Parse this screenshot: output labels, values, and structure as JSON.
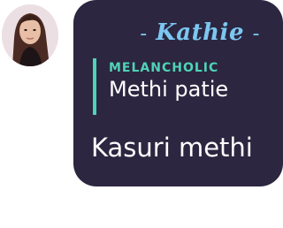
{
  "avatar": {
    "icon": "profile-photo"
  },
  "message": {
    "sender_dash_left": "-",
    "sender_name": "Kathie",
    "sender_dash_right": "-",
    "quote": {
      "title": "MELANCHOLIC",
      "text": "Methi patie"
    },
    "body": "Kasuri methi"
  },
  "colors": {
    "bubble": "#2c2640",
    "sender": "#7cc7f1",
    "quote_accent": "#4fd3b6",
    "text": "#ffffff"
  }
}
